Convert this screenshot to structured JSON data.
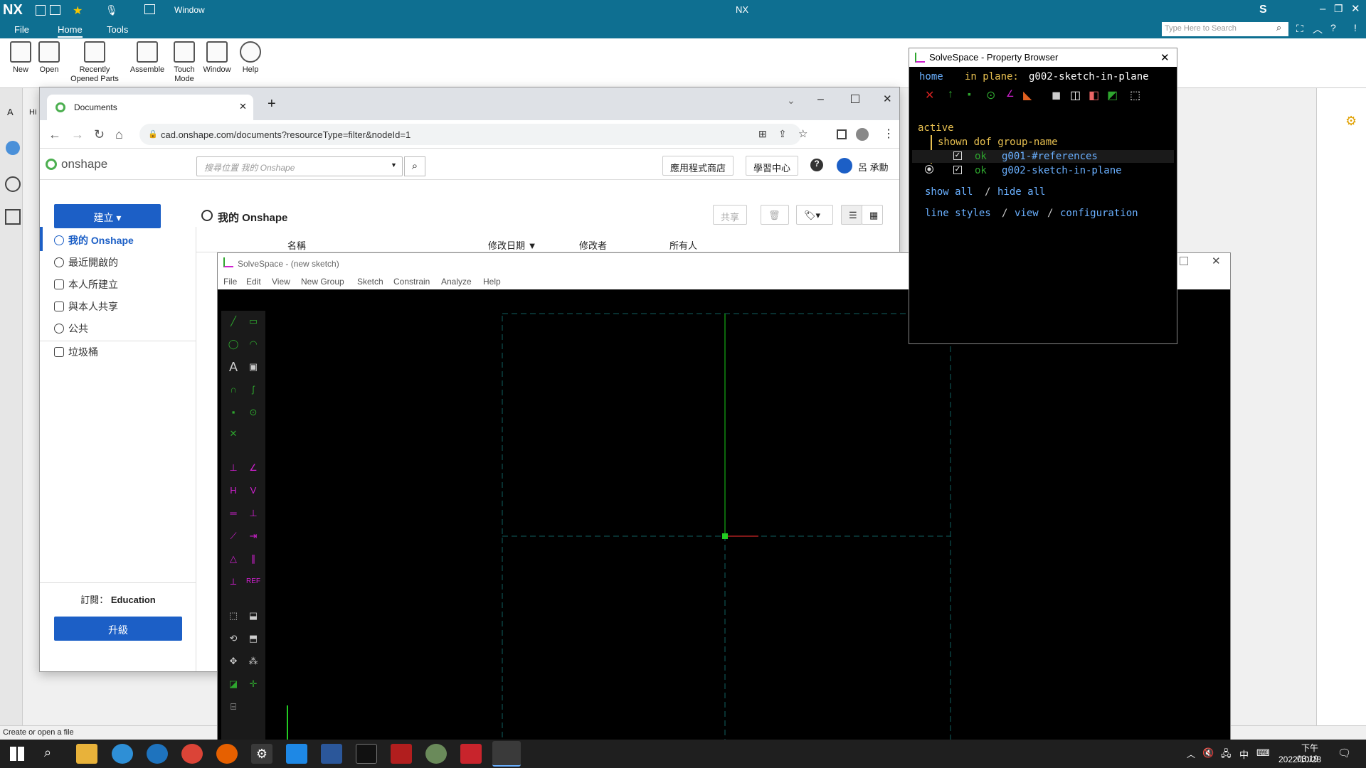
{
  "nx": {
    "logo": "NX",
    "title": "NX",
    "window_menu": "Window",
    "menu": {
      "file": "File",
      "home": "Home",
      "tools": "Tools"
    },
    "ribbon": [
      {
        "label": "New",
        "icon": "new-file-icon"
      },
      {
        "label": "Open",
        "icon": "open-folder-icon"
      },
      {
        "label": "Recently\nOpened Parts",
        "icon": "recent-parts-icon"
      },
      {
        "label": "Assemble",
        "icon": "assemble-icon"
      },
      {
        "label": "Touch\nMode",
        "icon": "touch-mode-icon"
      },
      {
        "label": "Window",
        "icon": "window-icon"
      },
      {
        "label": "Help",
        "icon": "help-icon"
      }
    ],
    "search_placeholder": "Type Here to Search",
    "status": "Create or open a file",
    "left_tab": "A",
    "history_tab": "Hi"
  },
  "chrome": {
    "tab_title": "Documents",
    "url": "cad.onshape.com/documents?resourceType=filter&nodeId=1"
  },
  "onshape": {
    "logo": "onshape",
    "search_placeholder": "搜尋位置 我的 Onshape",
    "app_store": "應用程式商店",
    "learning": "學習中心",
    "user": "呂 承勳",
    "create": "建立",
    "breadcrumb": "我的 Onshape",
    "share": "共享",
    "columns": [
      "名稱",
      "修改日期 ▼",
      "修改者",
      "所有人"
    ],
    "nav": [
      "我的 Onshape",
      "最近開啟的",
      "本人所建立",
      "與本人共享",
      "公共",
      "垃圾桶"
    ],
    "subscription_label": "訂閱：",
    "subscription_value": "Education",
    "upgrade": "升級"
  },
  "solvespace": {
    "title": "SolveSpace - (new sketch)",
    "menu": [
      "File",
      "Edit",
      "View",
      "New Group",
      "Sketch",
      "Constrain",
      "Analyze",
      "Help"
    ]
  },
  "property_browser": {
    "title": "SolveSpace - Property Browser",
    "home": "home",
    "in_plane_label": "in plane:",
    "in_plane_value": "g002-sketch-in-plane",
    "active": "active",
    "header": "shown dof group-name",
    "groups": [
      {
        "dof": "ok",
        "name": "g001-#references"
      },
      {
        "dof": "ok",
        "name": "g002-sketch-in-plane"
      }
    ],
    "show_all": "show all",
    "slash": "/",
    "hide_all": "hide all",
    "line_styles": "line styles",
    "view": "view",
    "configuration": "configuration"
  },
  "taskbar": {
    "ime": "中",
    "time": "下午 03:19",
    "date": "2022/10/28"
  }
}
